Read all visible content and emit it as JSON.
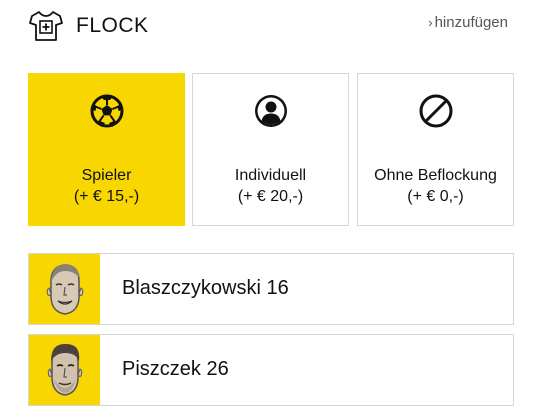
{
  "header": {
    "title": "FLOCK",
    "shirt_icon": "shirt-plus-icon",
    "add_link_chevron": "›",
    "add_link_label": "hinzufügen"
  },
  "accent_color": "#f8d700",
  "options": [
    {
      "label": "Spieler",
      "price": "(+ € 15,-)",
      "icon": "soccer-ball-icon",
      "selected": true
    },
    {
      "label": "Individuell",
      "price": "(+ € 20,-)",
      "icon": "person-icon",
      "selected": false
    },
    {
      "label": "Ohne Beflockung",
      "price": "(+ € 0,-)",
      "icon": "no-entry-icon",
      "selected": false
    }
  ],
  "players": [
    {
      "name": "Blaszczykowski 16",
      "photo": "player-photo-icon"
    },
    {
      "name": "Piszczek 26",
      "photo": "player-photo-icon"
    }
  ]
}
